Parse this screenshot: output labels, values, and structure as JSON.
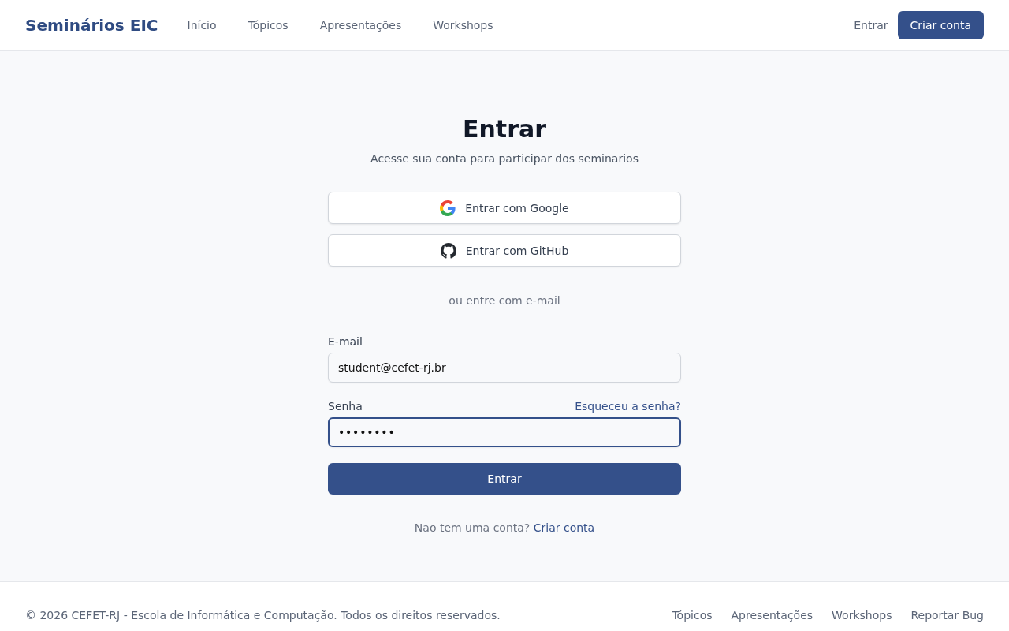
{
  "header": {
    "logo": "Seminários EIC",
    "nav": [
      "Início",
      "Tópicos",
      "Apresentações",
      "Workshops"
    ],
    "sign_in": "Entrar",
    "sign_up": "Criar conta"
  },
  "login": {
    "title": "Entrar",
    "subtitle": "Acesse sua conta para participar dos seminarios",
    "providers": [
      {
        "kind": "google",
        "label": "Entrar com Google"
      },
      {
        "kind": "github",
        "label": "Entrar com GitHub"
      }
    ],
    "divider": "ou entre com e-mail",
    "fields": [
      {
        "kind": "email",
        "label": "E-mail",
        "value": "student@cefet-rj.br",
        "focused": false
      },
      {
        "kind": "password",
        "label": "Senha",
        "link": "Esqueceu a senha?",
        "value": "••••••••",
        "focused": true
      }
    ],
    "submit": "Entrar",
    "signup_prompt": "Nao tem uma conta?",
    "signup_link": "Criar conta"
  },
  "footer": {
    "copyright": "© 2026 CEFET-RJ - Escola de Informática e Computação. Todos os direitos reservados.",
    "links": [
      "Tópicos",
      "Apresentações",
      "Workshops",
      "Reportar Bug"
    ]
  }
}
